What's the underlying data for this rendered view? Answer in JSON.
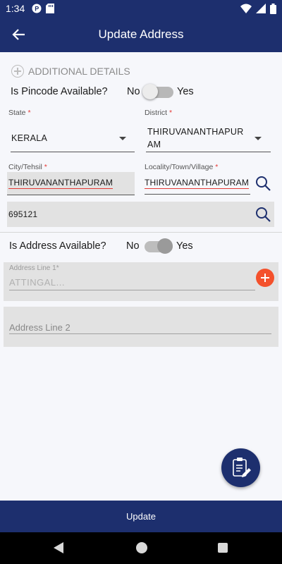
{
  "status_bar": {
    "time": "1:34",
    "icons_left": [
      "notification-p-icon",
      "sd-card-icon"
    ],
    "icons_right": [
      "wifi-icon",
      "signal-icon",
      "battery-icon"
    ]
  },
  "app_bar": {
    "title": "Update Address",
    "back_icon": "arrow-left-icon"
  },
  "form": {
    "additional_details": "ADDITIONAL DETAILS",
    "pincode_question": "Is Pincode Available?",
    "pincode_no": "No",
    "pincode_yes": "Yes",
    "pincode_toggle_on": false,
    "state_label": "State",
    "state_value": "KERALA",
    "district_label": "District",
    "district_value_line1": "THIRUVANANTHAPUR",
    "district_value_line2": "AM",
    "city_label": "City/Tehsil",
    "city_value": "THIRUVANANTHAPURAM",
    "locality_label": "Locality/Town/Village",
    "locality_value": "THIRUVANANTHAPURAM",
    "pincode_value": "695121",
    "required_mark": "*",
    "address_question": "Is Address Available?",
    "address_no": "No",
    "address_yes": "Yes",
    "address_toggle_on": false,
    "address_line1_label": "Address Line 1*",
    "address_line1_value": "ATTINGAL...",
    "address_line2_placeholder": "Address Line 2"
  },
  "update_button": "Update",
  "colors": {
    "primary": "#1d2f6e",
    "accent_red": "#e53935",
    "add_button": "#f4512c"
  }
}
